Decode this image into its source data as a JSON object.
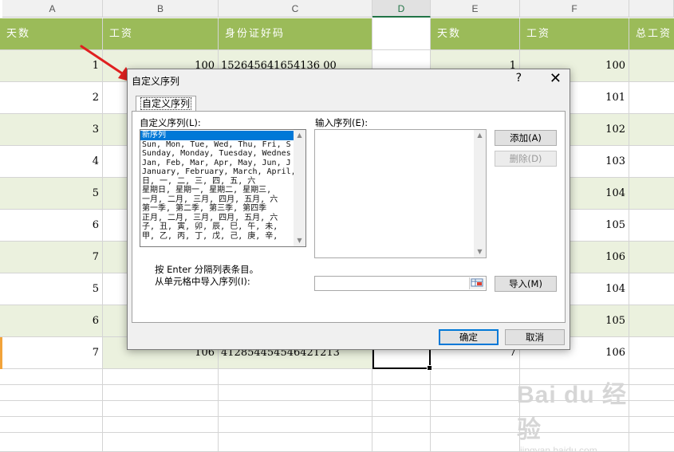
{
  "sheet": {
    "columns": [
      "A",
      "B",
      "C",
      "D",
      "E",
      "F"
    ],
    "header_row": {
      "a": "天数",
      "b": "工资",
      "c": "身份证好码",
      "e": "天数",
      "f": "工资",
      "g": "总工资"
    },
    "rows": [
      {
        "a": "1",
        "b": "100",
        "c": "152645641654136 00",
        "e": "1",
        "f": "100"
      },
      {
        "a": "2",
        "b": "",
        "c": "",
        "e": "",
        "f": "101"
      },
      {
        "a": "3",
        "b": "",
        "c": "",
        "e": "",
        "f": "102"
      },
      {
        "a": "4",
        "b": "",
        "c": "",
        "e": "",
        "f": "103"
      },
      {
        "a": "5",
        "b": "",
        "c": "",
        "e": "",
        "f": "104"
      },
      {
        "a": "6",
        "b": "",
        "c": "",
        "e": "",
        "f": "105"
      },
      {
        "a": "7",
        "b": "",
        "c": "",
        "e": "",
        "f": "106"
      },
      {
        "a": "5",
        "b": "",
        "c": "",
        "e": "",
        "f": "104"
      },
      {
        "a": "6",
        "b": "",
        "c": "",
        "e": "",
        "f": "105"
      },
      {
        "a": "7",
        "b": "106",
        "c": "412854454546421213",
        "e": "7",
        "f": "106"
      }
    ],
    "colors": {
      "header_green": "#9bbb59",
      "band_light_green": "#ebf1de",
      "active_accent": "#217346"
    }
  },
  "dialog": {
    "title": "自定义序列",
    "help_glyph": "?",
    "close_glyph": "✕",
    "tab_label": "自定义序列",
    "list_label": "自定义序列(L):",
    "list_items": [
      "新序列",
      "Sun, Mon, Tue, Wed, Thu, Fri, S",
      "Sunday, Monday, Tuesday, Wednes",
      "Jan, Feb, Mar, Apr, May, Jun, J",
      "January, February, March, April,",
      "日, 一, 二, 三, 四, 五, 六",
      "星期日, 星期一, 星期二, 星期三,",
      "一月, 二月, 三月, 四月, 五月, 六",
      "第一季, 第二季, 第三季, 第四季",
      "正月, 二月, 三月, 四月, 五月, 六",
      "子, 丑, 寅, 卯, 辰, 巳, 午, 未,",
      "甲, 乙, 丙, 丁, 戊, 己, 庚, 辛,"
    ],
    "selected_item": "新序列",
    "input_label": "输入序列(E):",
    "hint_text": "按 Enter 分隔列表条目。",
    "import_label": "从单元格中导入序列(I):",
    "buttons": {
      "add": "添加(A)",
      "delete": "删除(D)",
      "import": "导入(M)",
      "ok": "确定",
      "cancel": "取消"
    },
    "colors": {
      "selection_blue": "#0078d7"
    }
  },
  "watermark": {
    "logo": "Bai du 经验",
    "url": "jingyan.baidu.com"
  }
}
